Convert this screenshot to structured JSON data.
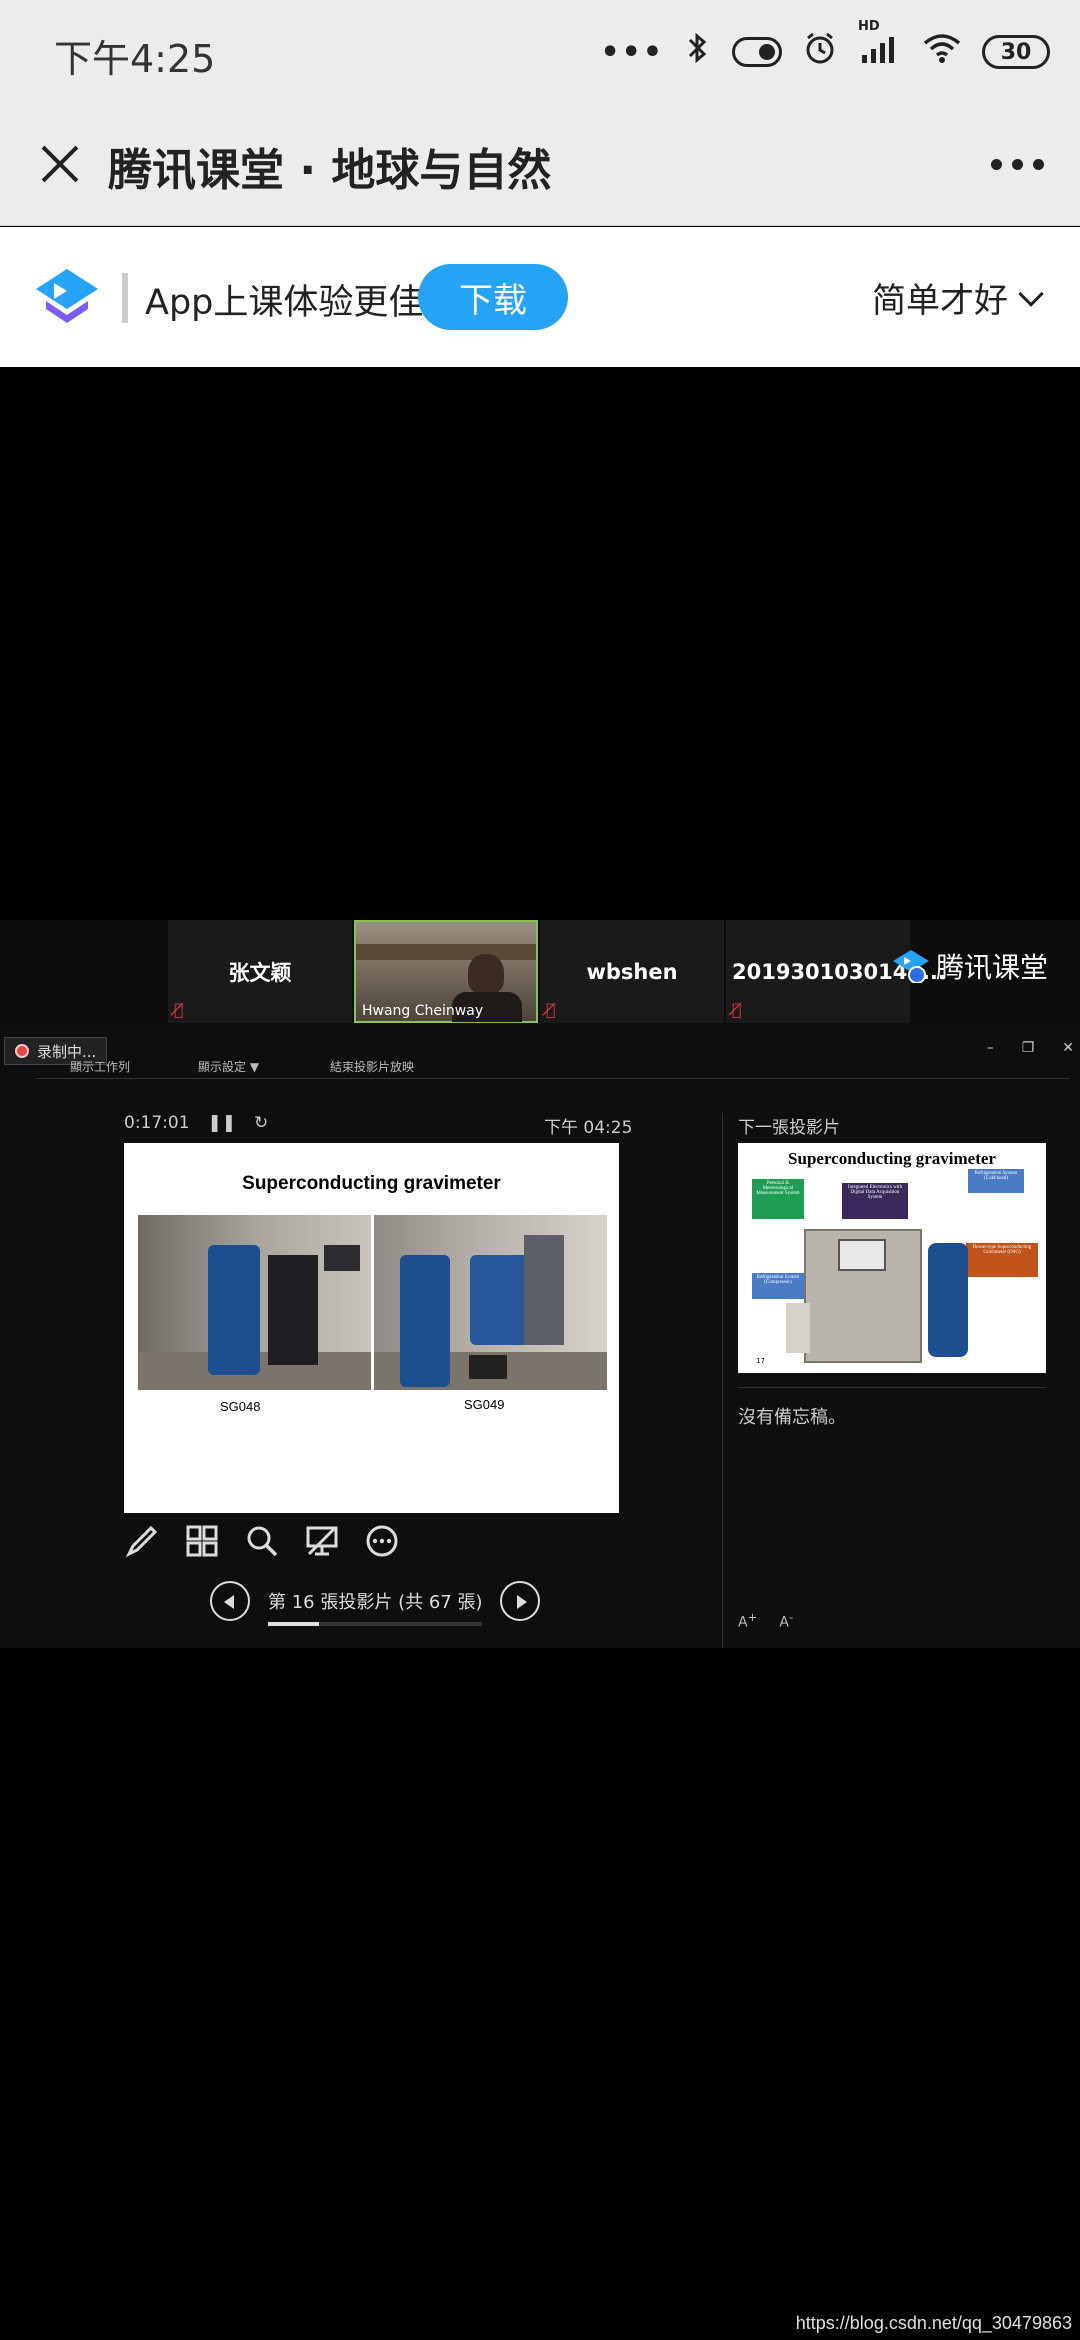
{
  "status_bar": {
    "time": "下午4:25",
    "battery": "30",
    "icons": [
      "more-dots-icon",
      "bluetooth-icon",
      "toggle-icon",
      "alarm-icon",
      "hd-signal-icon",
      "wifi-icon",
      "battery-icon"
    ],
    "hd_label": "HD"
  },
  "header": {
    "title": "腾讯课堂 · 地球与自然"
  },
  "banner": {
    "text": "App上课体验更佳",
    "download_label": "下载",
    "user_name": "简单才好",
    "brand_color": "#27a3f5"
  },
  "participants": [
    {
      "name": "张文颖",
      "muted": true
    },
    {
      "name": "Hwang Cheinway",
      "video": true
    },
    {
      "name": "wbshen",
      "muted": true
    },
    {
      "name": "2019301030141...",
      "muted": true
    }
  ],
  "watermark": "腾讯课堂",
  "ppt": {
    "recording_label": "录制中...",
    "toolbar": {
      "taskbar": "顯示工作列",
      "display_settings": "顯示設定 ▼",
      "end_show": "結束投影片放映"
    },
    "timer": "0:17:01",
    "clock": "下午 04:25",
    "next_slide_label": "下一張投影片",
    "current_slide": {
      "title": "Superconducting gravimeter",
      "captions": [
        "SG048",
        "SG049"
      ]
    },
    "next_slide": {
      "title": "Superconducting  gravimeter",
      "boxes": [
        "Personal & Meteorological Measurement System",
        "Integrated Electronics with Digital Data Acquisition System",
        "Refrigeration System (Cold head)",
        "Dewar-type Superconducting Gravimeter (OSG)",
        "Refrigeration System (Compressor)"
      ],
      "page_number": "17"
    },
    "slide_counter": "第 16 張投影片 (共 67 張)",
    "slide_index": 16,
    "slide_total": 67,
    "notes": "沒有備忘稿。",
    "tool_icons": [
      "pen-icon",
      "grid-icon",
      "zoom-icon",
      "screen-icon",
      "more-icon"
    ]
  },
  "footer_url": "https://blog.csdn.net/qq_30479863"
}
